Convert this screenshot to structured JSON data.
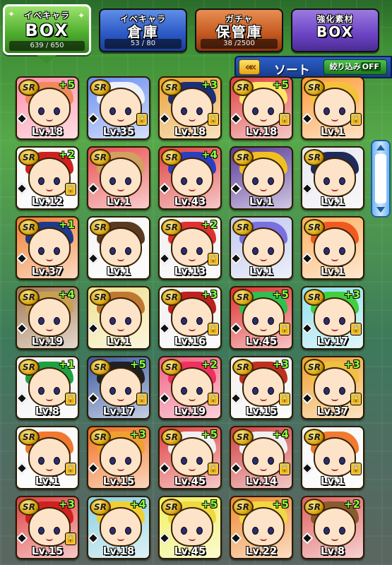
{
  "tabs": [
    {
      "line1": "イベキャラ",
      "line2": "BOX",
      "count": "639 / 650",
      "selected": true
    },
    {
      "line1": "イベキャラ",
      "line2": "倉庫",
      "count": "53 / 80",
      "selected": false
    },
    {
      "line1": "ガチャ",
      "line2": "保管庫",
      "count": "38 /2500",
      "selected": false
    },
    {
      "line1": "強化素材",
      "line2": "BOX",
      "count": "",
      "selected": false
    }
  ],
  "sortbar": {
    "back_icon": "««",
    "sort_label": "ソート",
    "filter_label": "絞り込み",
    "filter_state": "OFF"
  },
  "rarity_badge": "SR",
  "lock_glyph": "🔒",
  "cards": [
    {
      "plus": "+5",
      "level": "Lv.18",
      "lock": false,
      "hair": "#f08a5a",
      "bg": "#ff8fa8"
    },
    {
      "plus": "",
      "level": "Lv.35",
      "lock": true,
      "hair": "#f0f0f8",
      "bg": "#6a8ff0"
    },
    {
      "plus": "+3",
      "level": "Lv.18",
      "lock": true,
      "hair": "#1b2f7a",
      "bg": "#e8a030"
    },
    {
      "plus": "+5",
      "level": "Lv.18",
      "lock": true,
      "hair": "#ffe56b",
      "bg": "#e04040"
    },
    {
      "plus": "",
      "level": "Lv.1",
      "lock": true,
      "hair": "#f4c23a",
      "bg": "#ff9a3a"
    },
    {
      "plus": "+2",
      "level": "Lv.12",
      "lock": true,
      "hair": "#d02020",
      "bg": "#f7f7f7"
    },
    {
      "plus": "",
      "level": "Lv.1",
      "lock": false,
      "hair": "#d2a060",
      "bg": "#e85050"
    },
    {
      "plus": "+4",
      "level": "Lv.43",
      "lock": false,
      "hair": "#2a3fbf",
      "bg": "#e04040"
    },
    {
      "plus": "",
      "level": "Lv.1",
      "lock": false,
      "hair": "#f0c020",
      "bg": "#5a3a9a"
    },
    {
      "plus": "",
      "level": "Lv.1",
      "lock": false,
      "hair": "#202a5a",
      "bg": "#e8e8f0"
    },
    {
      "plus": "+1",
      "level": "Lv.37",
      "lock": false,
      "hair": "#1e3a8a",
      "bg": "#f08030"
    },
    {
      "plus": "",
      "level": "Lv.1",
      "lock": false,
      "hair": "#5a3a20",
      "bg": "#f6f6f6"
    },
    {
      "plus": "+2",
      "level": "Lv.13",
      "lock": true,
      "hair": "#e03030",
      "bg": "#f0f0f0"
    },
    {
      "plus": "",
      "level": "Lv.1",
      "lock": false,
      "hair": "#7a70e0",
      "bg": "#c0c8f0"
    },
    {
      "plus": "",
      "level": "Lv.1",
      "lock": false,
      "hair": "#f05a20",
      "bg": "#ffb060"
    },
    {
      "plus": "+4",
      "level": "Lv.19",
      "lock": false,
      "hair": "#c8a050",
      "bg": "#a07850"
    },
    {
      "plus": "",
      "level": "Lv.1",
      "lock": false,
      "hair": "#c07830",
      "bg": "#f0e090"
    },
    {
      "plus": "+3",
      "level": "Lv.16",
      "lock": true,
      "hair": "#c02020",
      "bg": "#f0f0f0"
    },
    {
      "plus": "+5",
      "level": "Lv.45",
      "lock": true,
      "hair": "#30c050",
      "bg": "#e03030"
    },
    {
      "plus": "+3",
      "level": "Lv.17",
      "lock": true,
      "hair": "#40d040",
      "bg": "#90e0f0"
    },
    {
      "plus": "+1",
      "level": "Lv.8",
      "lock": true,
      "hair": "#20a040",
      "bg": "#f0f0f0"
    },
    {
      "plus": "+5",
      "level": "Lv.17",
      "lock": true,
      "hair": "#202020",
      "bg": "#3a5aa0"
    },
    {
      "plus": "+2",
      "level": "Lv.19",
      "lock": true,
      "hair": "#f03060",
      "bg": "#f06080"
    },
    {
      "plus": "+3",
      "level": "Lv.15",
      "lock": true,
      "hair": "#c03020",
      "bg": "#f0f0f0"
    },
    {
      "plus": "+3",
      "level": "Lv.37",
      "lock": true,
      "hair": "#f0c040",
      "bg": "#f0a030"
    },
    {
      "plus": "",
      "level": "Lv.1",
      "lock": true,
      "hair": "#f07830",
      "bg": "#f8f8f8"
    },
    {
      "plus": "+3",
      "level": "Lv.15",
      "lock": false,
      "hair": "#f0a030",
      "bg": "#f07020"
    },
    {
      "plus": "+5",
      "level": "Lv.45",
      "lock": true,
      "hair": "#f0f0f0",
      "bg": "#e04040"
    },
    {
      "plus": "+4",
      "level": "Lv.14",
      "lock": true,
      "hair": "#f0f0f0",
      "bg": "#d04040"
    },
    {
      "plus": "",
      "level": "Lv.1",
      "lock": true,
      "hair": "#f07a30",
      "bg": "#f8f8f8"
    },
    {
      "plus": "+3",
      "level": "Lv.15",
      "lock": true,
      "hair": "#d02020",
      "bg": "#e04040"
    },
    {
      "plus": "+4",
      "level": "Lv.18",
      "lock": false,
      "hair": "#f0d030",
      "bg": "#8ad0e0"
    },
    {
      "plus": "+5",
      "level": "Lv.45",
      "lock": false,
      "hair": "#f0d840",
      "bg": "#f0f060"
    },
    {
      "plus": "+5",
      "level": "Lv.22",
      "lock": false,
      "hair": "#f0d840",
      "bg": "#f08a30"
    },
    {
      "plus": "+2",
      "level": "Lv.8",
      "lock": false,
      "hair": "#8a5a30",
      "bg": "#e06060"
    }
  ]
}
